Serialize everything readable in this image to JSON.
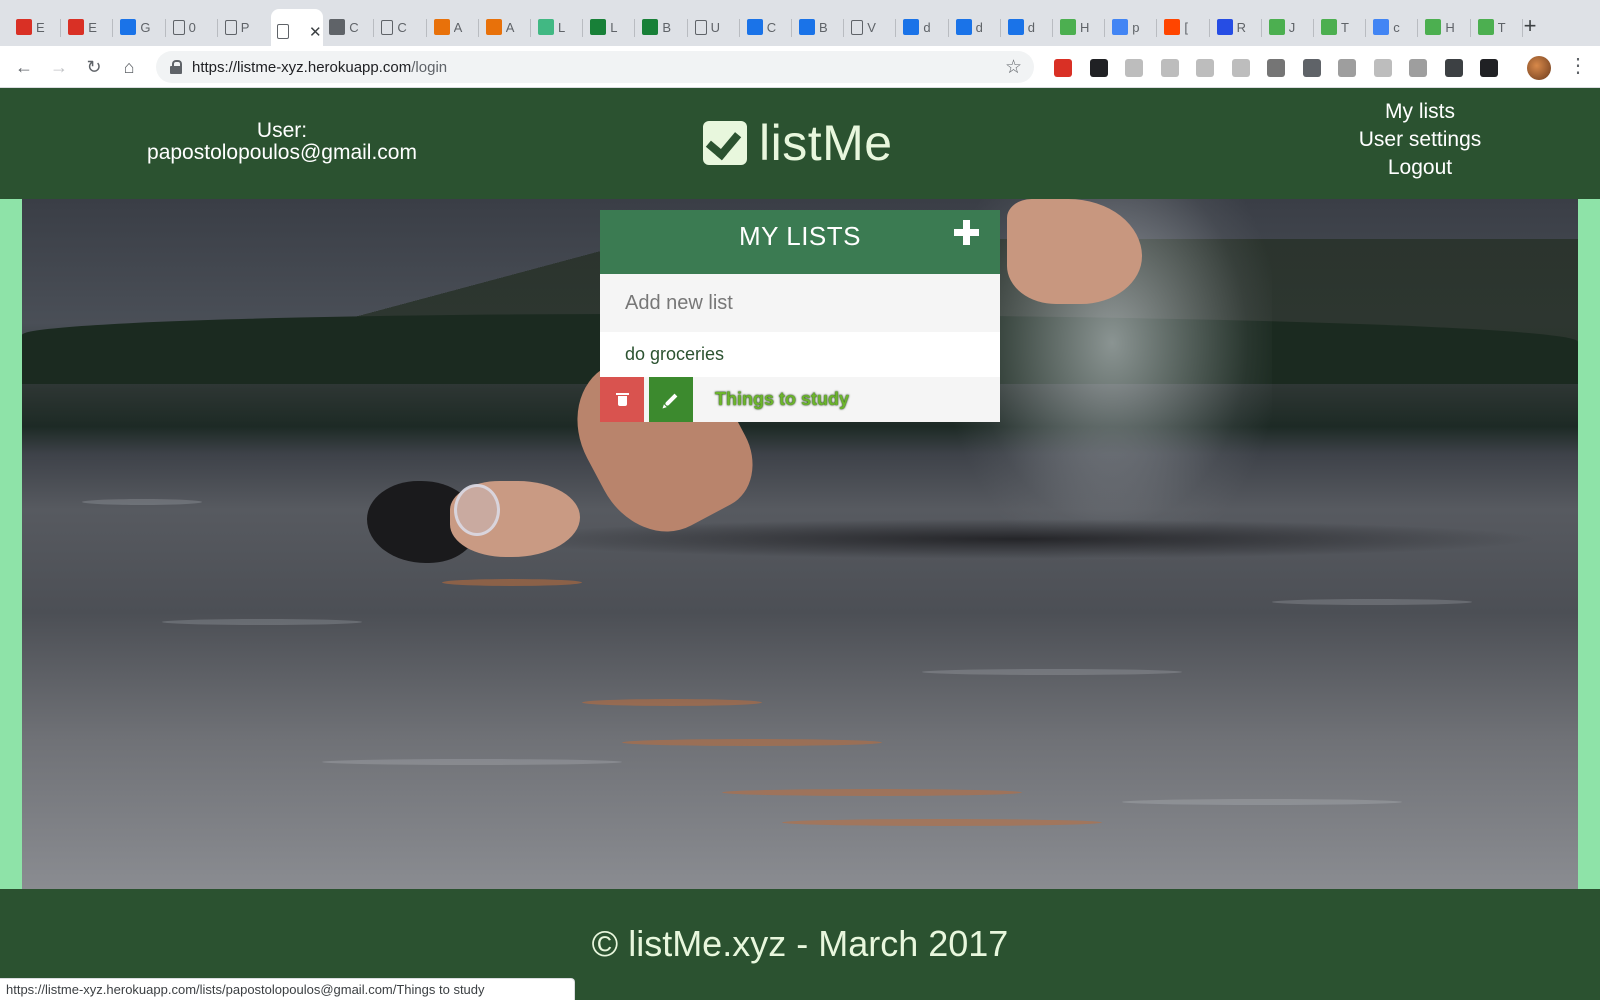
{
  "browser": {
    "tabs": [
      {
        "icon": "gmail-icon",
        "label": "E",
        "color": "#d93025"
      },
      {
        "icon": "gmail-icon",
        "label": "E",
        "color": "#d93025"
      },
      {
        "icon": "calendar-icon",
        "label": "G",
        "color": "#1a73e8"
      },
      {
        "icon": "document-icon",
        "label": "0",
        "color": "#5f6368"
      },
      {
        "icon": "document-icon",
        "label": "P",
        "color": "#5f6368"
      },
      {
        "icon": "document-icon",
        "label": "",
        "color": "#5f6368",
        "active": true
      },
      {
        "icon": "aperture-icon",
        "label": "C",
        "color": "#5f6368"
      },
      {
        "icon": "document-icon",
        "label": "C",
        "color": "#5f6368"
      },
      {
        "icon": "asterisk-icon",
        "label": "A",
        "color": "#e8710a"
      },
      {
        "icon": "asterisk-icon",
        "label": "A",
        "color": "#e8710a"
      },
      {
        "icon": "vue-icon",
        "label": "L",
        "color": "#41b883"
      },
      {
        "icon": "sheet-icon",
        "label": "L",
        "color": "#188038"
      },
      {
        "icon": "sheet-icon",
        "label": "B",
        "color": "#188038"
      },
      {
        "icon": "document-icon",
        "label": "U",
        "color": "#5f6368"
      },
      {
        "icon": "shield-icon",
        "label": "C",
        "color": "#1a73e8"
      },
      {
        "icon": "shield-icon",
        "label": "B",
        "color": "#1a73e8"
      },
      {
        "icon": "document-icon",
        "label": "V",
        "color": "#5f6368"
      },
      {
        "icon": "bird-icon",
        "label": "d",
        "color": "#1a73e8"
      },
      {
        "icon": "bird-icon",
        "label": "d",
        "color": "#1a73e8"
      },
      {
        "icon": "bird-icon",
        "label": "d",
        "color": "#1a73e8"
      },
      {
        "icon": "w3-icon",
        "label": "H",
        "color": "#4caf50"
      },
      {
        "icon": "google-icon",
        "label": "p",
        "color": "#4285f4"
      },
      {
        "icon": "reddit-icon",
        "label": "[",
        "color": "#ff4500"
      },
      {
        "icon": "css3-icon",
        "label": "R",
        "color": "#264de4"
      },
      {
        "icon": "w3-icon",
        "label": "J",
        "color": "#4caf50"
      },
      {
        "icon": "w3-icon",
        "label": "T",
        "color": "#4caf50"
      },
      {
        "icon": "google-icon",
        "label": "c",
        "color": "#4285f4"
      },
      {
        "icon": "w3-icon",
        "label": "H",
        "color": "#4caf50"
      },
      {
        "icon": "w3-icon",
        "label": "T",
        "color": "#4caf50"
      }
    ],
    "url_host": "https://listme-xyz.herokuapp.com",
    "url_path": "/login",
    "status_url": "https://listme-xyz.herokuapp.com/lists/papostolopoulos@gmail.com/Things to study",
    "extensions": [
      {
        "icon": "adblock-icon",
        "color": "#d93025"
      },
      {
        "icon": "incognito-icon",
        "color": "#202124"
      },
      {
        "icon": "ghost-icon",
        "color": "#bdbdbd"
      },
      {
        "icon": "es-icon",
        "color": "#bdbdbd"
      },
      {
        "icon": "qr-icon",
        "color": "#bdbdbd"
      },
      {
        "icon": "box-icon",
        "color": "#bdbdbd"
      },
      {
        "icon": "vuejs-devtools-icon",
        "color": "#757575"
      },
      {
        "icon": "lighthouse-icon",
        "color": "#5f6368"
      },
      {
        "icon": "badge-icon",
        "color": "#9e9e9e"
      },
      {
        "icon": "printer-icon",
        "color": "#bdbdbd"
      },
      {
        "icon": "circle-icon",
        "color": "#9e9e9e"
      },
      {
        "icon": "download-icon",
        "color": "#3c4043"
      },
      {
        "icon": "shield-black-icon",
        "color": "#202124"
      }
    ]
  },
  "header": {
    "user_label": "User:",
    "user_email": "papostolopoulos@gmail.com",
    "brand": "listMe",
    "nav": [
      "My lists",
      "User settings",
      "Logout"
    ]
  },
  "lists": {
    "title": "MY LISTS",
    "new_list_placeholder": "Add new list",
    "items": [
      "do groceries",
      "Things to study"
    ]
  },
  "footer": {
    "text": "© listMe.xyz - March 2017"
  },
  "colors": {
    "header_bg": "#2b5230",
    "panel_header": "#3b7b52",
    "delete": "#d9534f",
    "edit": "#3c8a2e",
    "side_accent": "#8ee3a8"
  }
}
